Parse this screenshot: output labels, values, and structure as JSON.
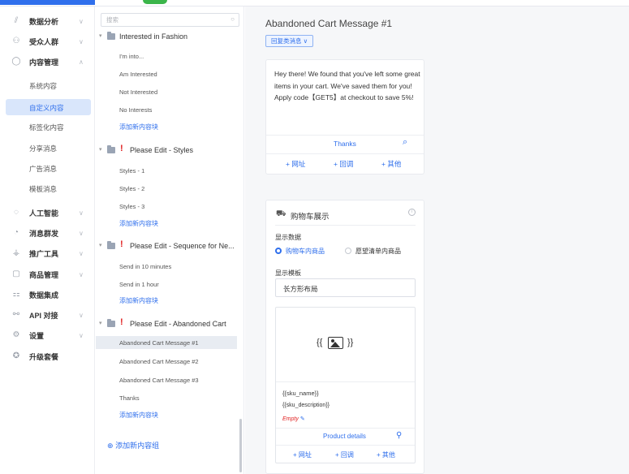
{
  "sidebar": {
    "items": [
      {
        "icon": "chart-icon",
        "glyph": "⫽",
        "label": "数据分析"
      },
      {
        "icon": "users-icon",
        "glyph": "⚇",
        "label": "受众人群"
      },
      {
        "icon": "chat-icon",
        "glyph": "◯",
        "label": "内容管理"
      },
      {
        "icon": "ai-icon",
        "glyph": "◌",
        "label": "人工智能"
      },
      {
        "icon": "broadcast-icon",
        "glyph": "◔",
        "label": "消息群发"
      },
      {
        "icon": "promo-icon",
        "glyph": "⚶",
        "label": "推广工具"
      },
      {
        "icon": "product-icon",
        "glyph": "▢",
        "label": "商品管理"
      },
      {
        "icon": "integration-icon",
        "glyph": "⚏",
        "label": "数据集成"
      },
      {
        "icon": "api-icon",
        "glyph": "⚯",
        "label": "API 对接"
      },
      {
        "icon": "settings-icon",
        "glyph": "⚙",
        "label": "设置"
      },
      {
        "icon": "upgrade-icon",
        "glyph": "✪",
        "label": "升级套餐"
      }
    ],
    "content_sub": [
      "系统内容",
      "自定义内容",
      "标签化内容",
      "分享消息",
      "广告消息",
      "模板消息"
    ]
  },
  "tree": {
    "search_placeholder": "搜索",
    "folders": [
      {
        "name": "Interested in Fashion",
        "items": [
          "I'm into...",
          "Am Interested",
          "Not Interested",
          "No Interests"
        ]
      },
      {
        "name": "Please Edit - Styles",
        "items": [
          "Styles - 1",
          "Styles - 2",
          "Styles - 3"
        ]
      },
      {
        "name": "Please Edit - Sequence for Ne...",
        "items": [
          "Send in 10 minutes",
          "Send in 1 hour"
        ]
      },
      {
        "name": "Please Edit - Abandoned Cart",
        "items": [
          "Abandoned Cart Message #1",
          "Abandoned Cart Message #2",
          "Abandoned Cart Message #3",
          "Thanks"
        ]
      }
    ],
    "add_content": "添加新内容块",
    "add_group": "添加新内容组"
  },
  "main": {
    "title": "Abandoned Cart Message #1",
    "reply_tag": "回复类消息 ∨",
    "message": "Hey there! We found that you've left some great items in your cart. We've saved them for you!\nApply code【GET5】at checkout to save 5%!",
    "button_label": "Thanks",
    "actions": [
      "+ 网址",
      "+ 回调",
      "+ 其他"
    ],
    "cart": {
      "title": "购物车展示",
      "display_data_label": "显示数据",
      "option_cart": "购物车内商品",
      "option_wishlist": "愿望清单内商品",
      "template_label": "显示模板",
      "template_value": "长方形布局",
      "image_placeholder": "{{ }}",
      "sku_name": "{{sku_name}}",
      "sku_description": "{{sku_description}}",
      "empty": "Empty",
      "product_details": "Product details",
      "actions": [
        "+ 网址",
        "+ 回调",
        "+ 其他"
      ]
    }
  },
  "colors": {
    "accent": "#2f6fec",
    "warning": "#e02020"
  }
}
